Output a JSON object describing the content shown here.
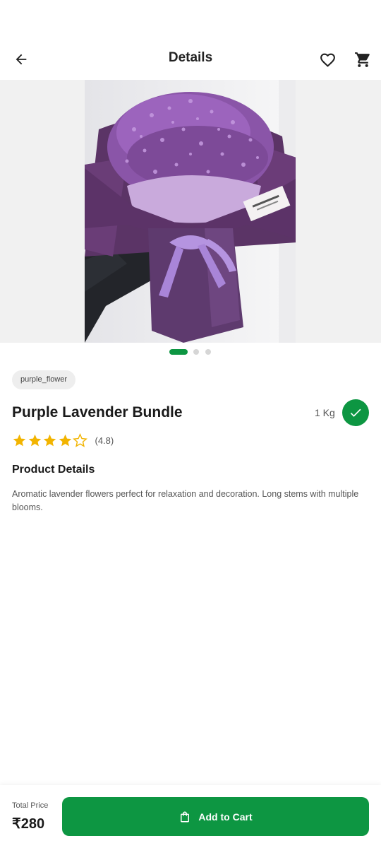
{
  "header": {
    "title": "Details",
    "back_icon": "arrow-back-icon",
    "favorite_icon": "heart-outline-icon",
    "cart_icon": "cart-icon"
  },
  "gallery": {
    "image_alt": "purple baby's breath bouquet",
    "slide_count": 3,
    "active_slide": 1
  },
  "product": {
    "tag": "purple_flower",
    "name": "Purple Lavender Bundle",
    "weight": "1 Kg",
    "rating_stars": 4,
    "rating_max": 5,
    "rating_text": "(4.8)",
    "details_heading": "Product Details",
    "description": "Aromatic lavender flowers perfect for relaxation and decoration. Long stems with multiple blooms."
  },
  "footer": {
    "total_label": "Total Price",
    "total_price": "₹280",
    "add_button": "Add to Cart"
  },
  "colors": {
    "accent": "#0d9642",
    "star": "#f2b400",
    "bouquet": "#5e3a6e"
  }
}
